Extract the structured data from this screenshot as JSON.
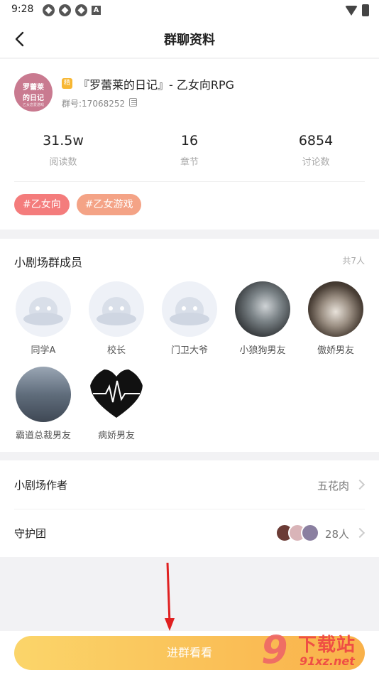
{
  "status_bar": {
    "time": "9:28",
    "icons": [
      "app-icon",
      "app-icon",
      "app-icon",
      "a-icon"
    ],
    "right_icons": [
      "wifi-icon",
      "battery-icon"
    ]
  },
  "nav": {
    "title": "群聊资料"
  },
  "group": {
    "avatar_line1": "罗蕾莱",
    "avatar_line2": "的日记",
    "avatar_line3": "乙女恋爱游戏",
    "badge": "精",
    "name": "『罗蕾莱的日记』- 乙女向RPG",
    "id": "群号:17068252"
  },
  "stats": [
    {
      "value": "31.5w",
      "label": "阅读数"
    },
    {
      "value": "16",
      "label": "章节"
    },
    {
      "value": "6854",
      "label": "讨论数"
    }
  ],
  "tags": [
    "#乙女向",
    "#乙女游戏"
  ],
  "members_section": {
    "title": "小剧场群成员",
    "count": "共7人",
    "members": [
      {
        "name": "同学A",
        "avatar": "placeholder"
      },
      {
        "name": "校长",
        "avatar": "placeholder"
      },
      {
        "name": "门卫大爷",
        "avatar": "placeholder"
      },
      {
        "name": "小狼狗男友",
        "avatar": "wolf"
      },
      {
        "name": "傲娇男友",
        "avatar": "cat"
      },
      {
        "name": "霸道总裁男友",
        "avatar": "suit"
      },
      {
        "name": "病娇男友",
        "avatar": "heart"
      }
    ]
  },
  "info": {
    "author_label": "小剧场作者",
    "author_value": "五花肉",
    "guard_label": "守护团",
    "guard_value": "28人"
  },
  "bottom": {
    "join_label": "进群看看"
  },
  "watermark": {
    "mark": "9",
    "name": "下载站",
    "url": "91xz.net"
  },
  "colors": {
    "accent": "#f9b14a",
    "tag_primary": "#f47c7c",
    "tag_secondary": "#f4a386",
    "badge": "#f7b733"
  }
}
